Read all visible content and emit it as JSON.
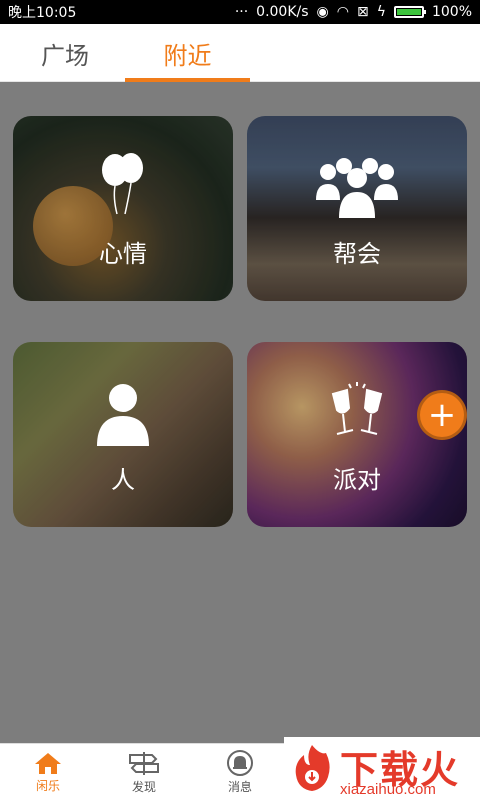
{
  "status_bar": {
    "time": "晚上10:05",
    "network_speed": "0.00K/s",
    "battery_percent": "100%",
    "battery_level": 1.0
  },
  "tabs": [
    {
      "label": "广场",
      "active": false
    },
    {
      "label": "附近",
      "active": true
    }
  ],
  "accent_color": "#f07c1a",
  "cards": {
    "mood": {
      "label": "心情",
      "icon": "balloons-icon"
    },
    "gang": {
      "label": "帮会",
      "icon": "group-icon"
    },
    "person": {
      "label": "人",
      "icon": "person-icon"
    },
    "party": {
      "label": "派对",
      "icon": "wine-glasses-icon"
    }
  },
  "fab": {
    "symbol": "+"
  },
  "bottom_nav": [
    {
      "label": "闲乐",
      "icon": "home-icon",
      "active": true
    },
    {
      "label": "发现",
      "icon": "signpost-icon",
      "active": false
    },
    {
      "label": "消息",
      "icon": "bell-icon",
      "active": false
    }
  ],
  "watermark": {
    "title": "下载火",
    "url": "xiazaihuo.com"
  }
}
